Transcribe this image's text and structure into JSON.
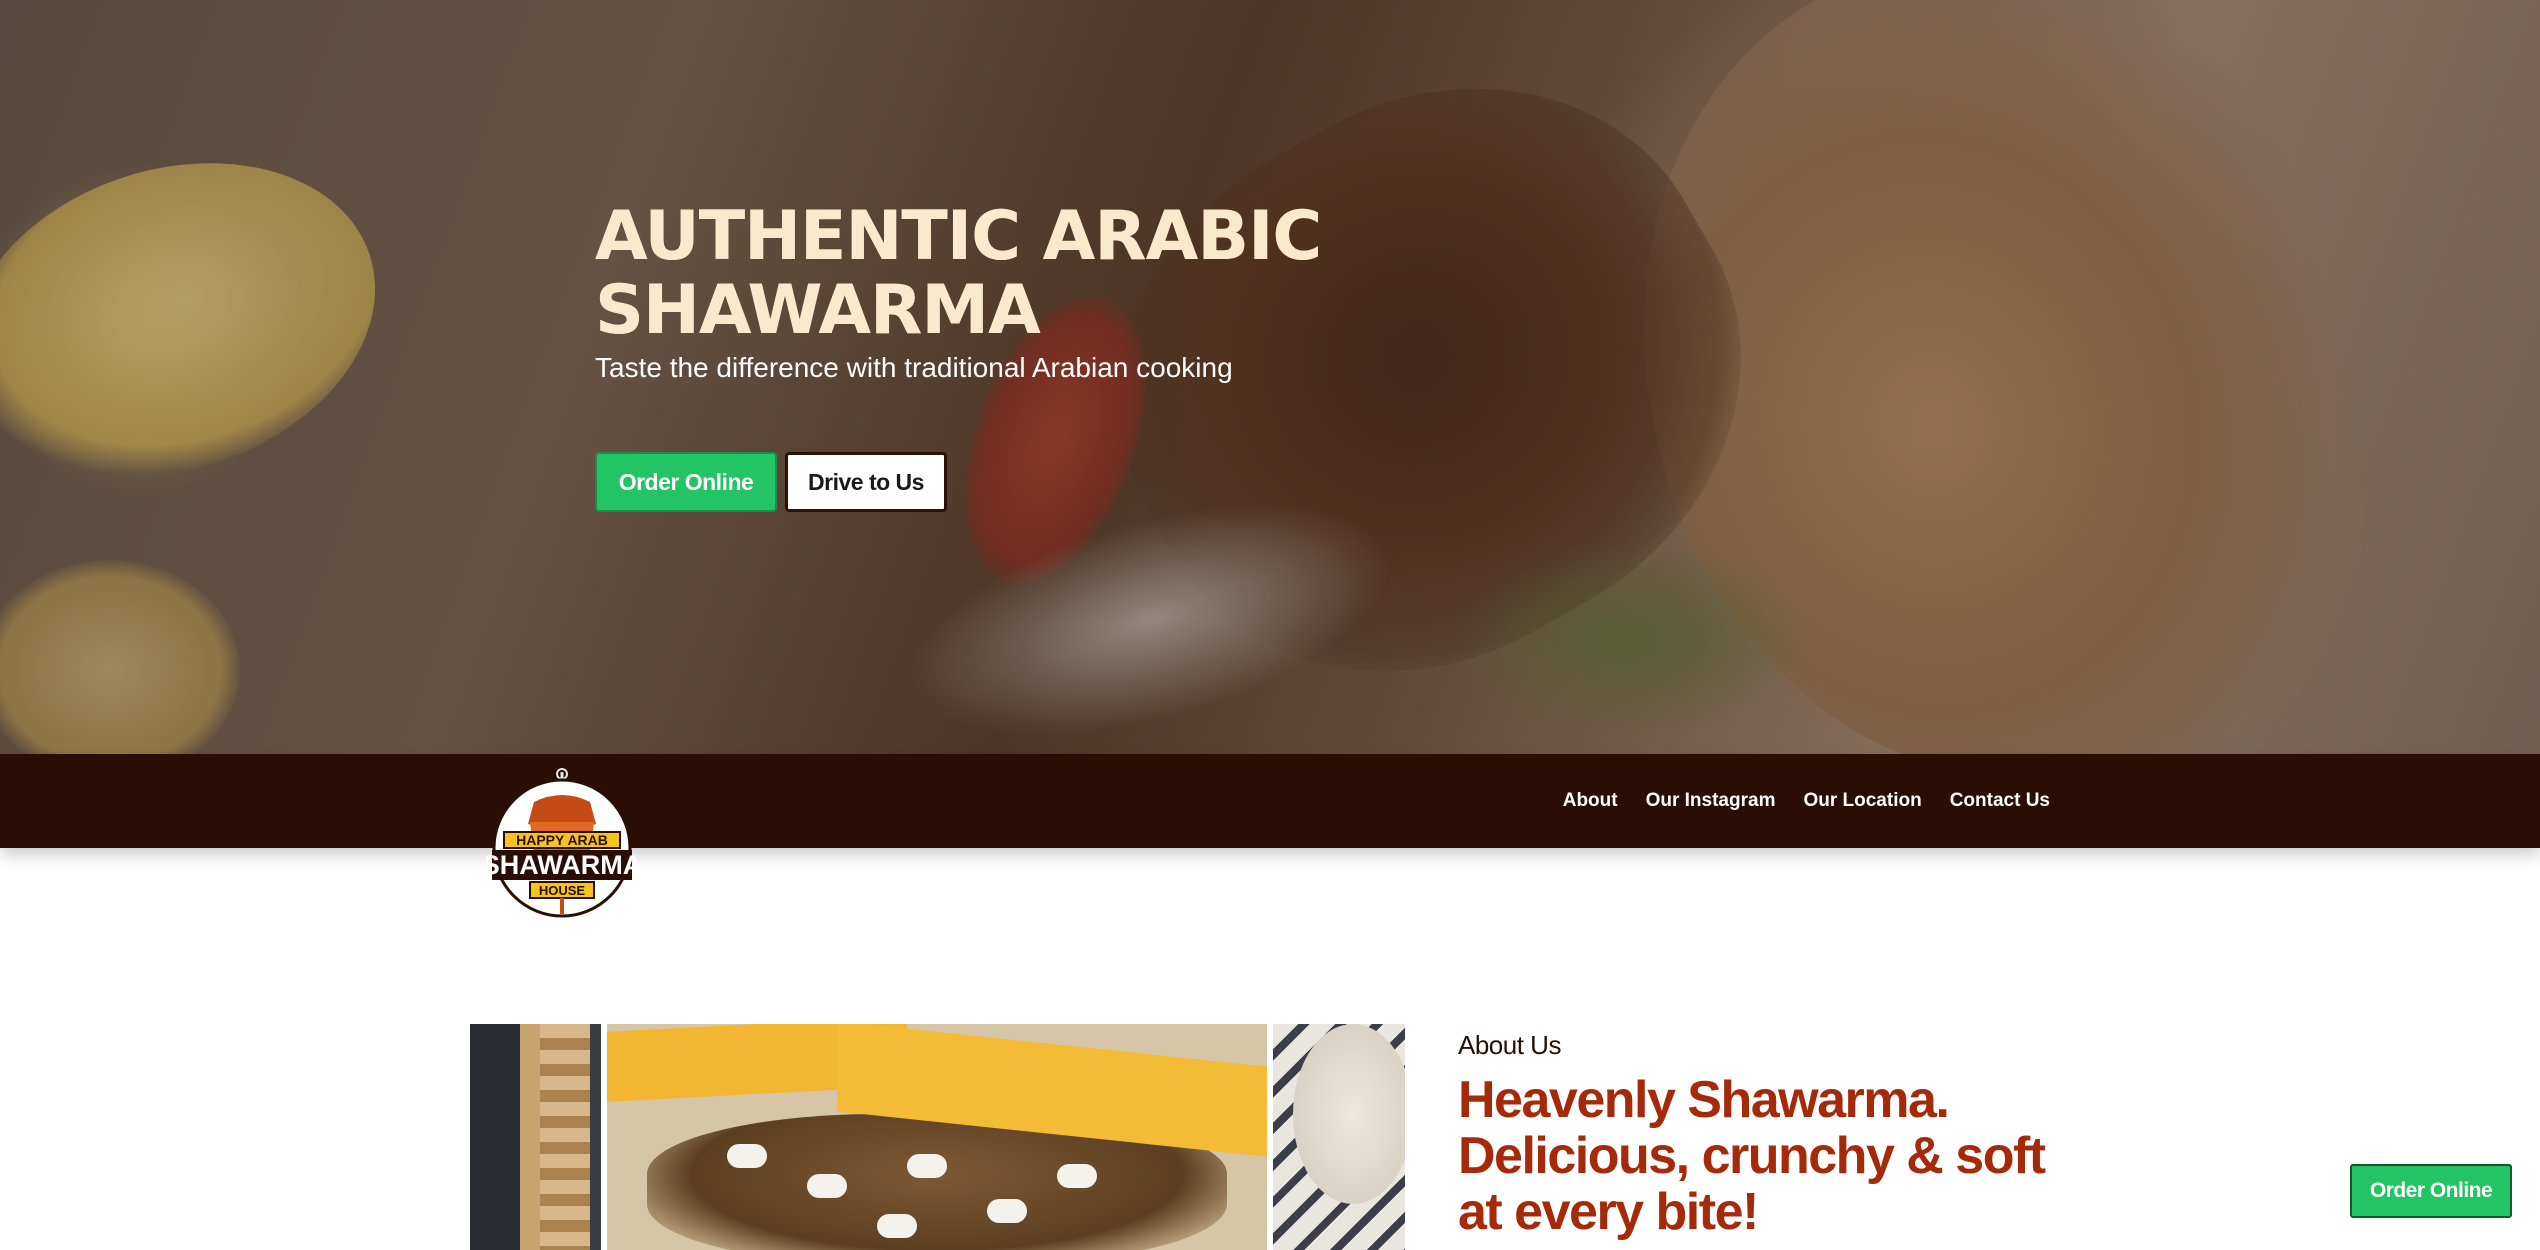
{
  "hero": {
    "title_line1": "AUTHENTIC ARABIC",
    "title_line2": "SHAWARMA",
    "subtitle": "Taste the difference with traditional Arabian cooking",
    "primary_button": "Order Online",
    "secondary_button": "Drive to Us"
  },
  "nav": {
    "logo": {
      "line1": "HAPPY ARAB",
      "line2": "SHAWARMA",
      "line3": "HOUSE"
    },
    "links": [
      "About",
      "Our Instagram",
      "Our Location",
      "Contact Us"
    ]
  },
  "about": {
    "label": "About Us",
    "heading": "Heavenly Shawarma. Delicious, crunchy & soft at every bite!"
  },
  "floating_button": "Order Online",
  "colors": {
    "nav_bg": "#2b0e03",
    "accent_green": "#22c466",
    "heading_red": "#a52a0a"
  }
}
